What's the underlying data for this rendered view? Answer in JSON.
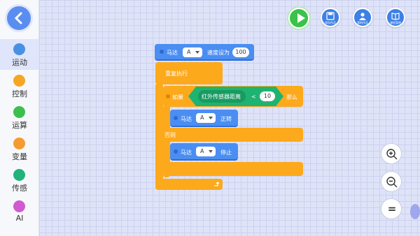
{
  "sidebar": {
    "back_icon": "chevron-left-icon",
    "categories": [
      {
        "label": "运动",
        "color": "#4a90e2"
      },
      {
        "label": "控制",
        "color": "#f5a623"
      },
      {
        "label": "运算",
        "color": "#3cbf4f"
      },
      {
        "label": "变量",
        "color": "#f59b30"
      },
      {
        "label": "传感",
        "color": "#21b37a"
      },
      {
        "label": "AI",
        "color": "#d05bd0"
      }
    ]
  },
  "toolbar": {
    "run_icon": "play-icon",
    "save_label": "保存作品",
    "my_works_label": "我的作品",
    "course_label": "课程案例"
  },
  "blocks": {
    "motor1": {
      "label": "马达",
      "port": "A",
      "action": "速度设为",
      "value": "100"
    },
    "repeat": {
      "label": "重复执行"
    },
    "if": {
      "label": "如果",
      "then": "那么",
      "sensor": "红外传感器距离",
      "op": "<",
      "value": "10"
    },
    "motor2": {
      "label": "马达",
      "port": "A",
      "action": "正转"
    },
    "else": {
      "label": "否则"
    },
    "motor3": {
      "label": "马达",
      "port": "A",
      "action": "停止"
    }
  },
  "zoom": {
    "in_icon": "zoom-in-icon",
    "out_icon": "zoom-out-icon",
    "reset_label": "="
  }
}
